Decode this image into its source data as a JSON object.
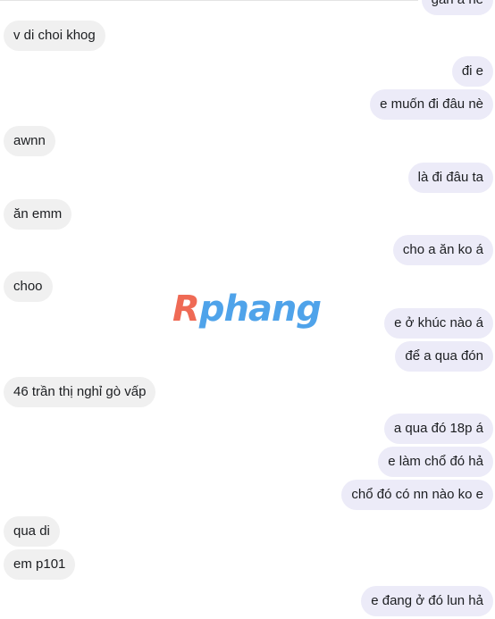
{
  "watermark": {
    "first": "R",
    "rest": "phang"
  },
  "messages": [
    {
      "side": "out",
      "text": "gần a nè"
    },
    {
      "side": "in",
      "text": "v di choi khog"
    },
    {
      "side": "out",
      "text": "đi e"
    },
    {
      "side": "out",
      "text": "e muốn đi đâu nè"
    },
    {
      "side": "in",
      "text": "awnn"
    },
    {
      "side": "out",
      "text": "là đi đâu ta"
    },
    {
      "side": "in",
      "text": "ăn emm"
    },
    {
      "side": "out",
      "text": "cho a ăn ko á"
    },
    {
      "side": "in",
      "text": "choo"
    },
    {
      "side": "out",
      "text": "e ở khúc nào á"
    },
    {
      "side": "out",
      "text": "để a qua đón"
    },
    {
      "side": "in",
      "text": "46 trần thị nghỉ gò vấp"
    },
    {
      "side": "out",
      "text": "a qua đó 18p á"
    },
    {
      "side": "out",
      "text": "e làm chổ đó hả"
    },
    {
      "side": "out",
      "text": "chổ đó có nn nào ko e"
    },
    {
      "side": "in",
      "text": "qua di"
    },
    {
      "side": "in",
      "text": "em p101"
    },
    {
      "side": "out",
      "text": "e đang ở đó lun hả"
    }
  ]
}
